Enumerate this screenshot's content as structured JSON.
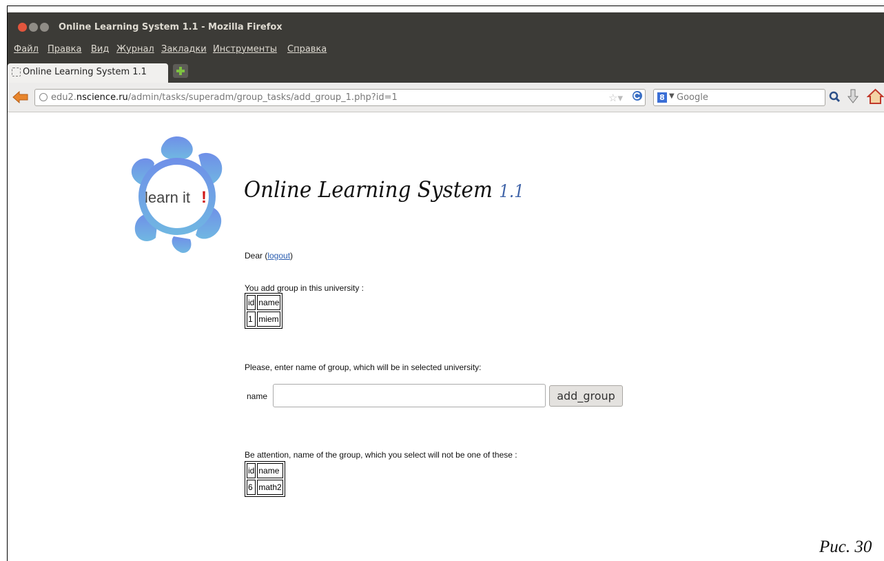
{
  "window": {
    "title": "Online Learning System 1.1 - Mozilla Firefox"
  },
  "menu": [
    "Файл",
    "Правка",
    "Вид",
    "Журнал",
    "Закладки",
    "Инструменты",
    "Справка"
  ],
  "tab": {
    "label": "Online Learning System 1.1"
  },
  "address": {
    "prefix": "edu2.",
    "domain": "nscience.ru",
    "path": "/admin/tasks/superadm/group_tasks/add_group_1.php?id=1"
  },
  "search": {
    "engine": "Google"
  },
  "logo": {
    "text": "learn it",
    "mark": "!"
  },
  "page": {
    "title": "Online Learning System",
    "version": "1.1",
    "greeting": "Dear (",
    "logout": "logout",
    "greeting_end": ")",
    "added_intro": "You add group in this university :",
    "added_table": {
      "headers": [
        "id",
        "name"
      ],
      "rows": [
        [
          "1",
          "miem"
        ]
      ]
    },
    "prompt": "Please, enter name of group, which will be in selected university:",
    "form": {
      "label": "name",
      "value": "",
      "button": "add_group"
    },
    "exclude_intro": "Be attention, name of the group, which you select will not be one of these :",
    "exclude_table": {
      "headers": [
        "id",
        "name"
      ],
      "rows": [
        [
          "6",
          "math2"
        ]
      ]
    }
  },
  "caption": "Рис. 30"
}
